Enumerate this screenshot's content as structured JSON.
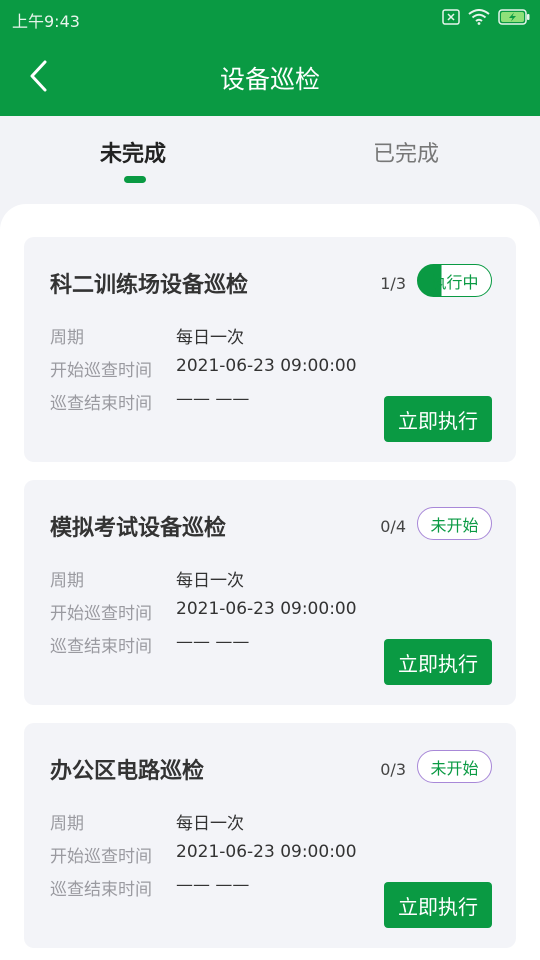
{
  "status": {
    "time": "上午9:43"
  },
  "header": {
    "title": "设备巡检"
  },
  "tabs": [
    {
      "label": "未完成",
      "active": true
    },
    {
      "label": "已完成",
      "active": false
    }
  ],
  "labels": {
    "period": "周期",
    "start_time": "开始巡查时间",
    "end_time": "巡查结束时间"
  },
  "cards": [
    {
      "title": "科二训练场设备巡检",
      "progress": "1/3",
      "status": "执行中",
      "period": "每日一次",
      "start_time": "2021-06-23 09:00:00",
      "end_time": "—— ——",
      "action": "立即执行"
    },
    {
      "title": "模拟考试设备巡检",
      "progress": "0/4",
      "status": "未开始",
      "period": "每日一次",
      "start_time": "2021-06-23 09:00:00",
      "end_time": "—— ——",
      "action": "立即执行"
    },
    {
      "title": "办公区电路巡检",
      "progress": "0/3",
      "status": "未开始",
      "period": "每日一次",
      "start_time": "2021-06-23 09:00:00",
      "end_time": "—— ——",
      "action": "立即执行"
    }
  ],
  "colors": {
    "brand": "#0a9a43",
    "pending_border": "#a888d8"
  }
}
